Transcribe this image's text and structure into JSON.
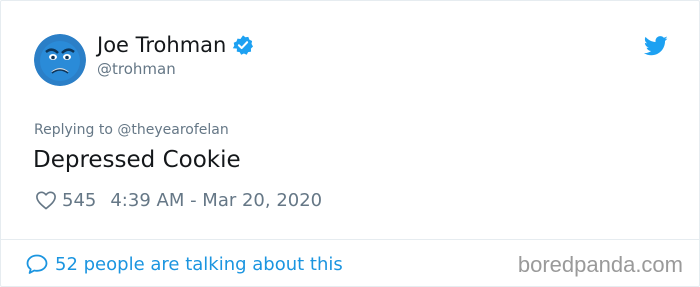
{
  "author": {
    "name": "Joe Trohman",
    "handle": "@trohman",
    "avatar_icon": "blue-sad-face-avatar",
    "verified_icon": "verified-badge-icon"
  },
  "brand_icon": "twitter-bird-icon",
  "reply": {
    "prefix": "Replying to",
    "handle": "@theyearofelan"
  },
  "tweet": {
    "text": "Depressed Cookie",
    "like_icon": "heart-icon",
    "like_count": "545",
    "timestamp": "4:39 AM - Mar 20, 2020"
  },
  "footer": {
    "talking_icon": "speech-bubble-icon",
    "talking_text": "52 people are talking about this",
    "watermark": "boredpanda.com"
  },
  "colors": {
    "text_primary": "#14171a",
    "text_secondary": "#657786",
    "link_blue": "#1b95e0",
    "twitter_blue": "#1da1f2",
    "border": "#e6ecf0"
  }
}
